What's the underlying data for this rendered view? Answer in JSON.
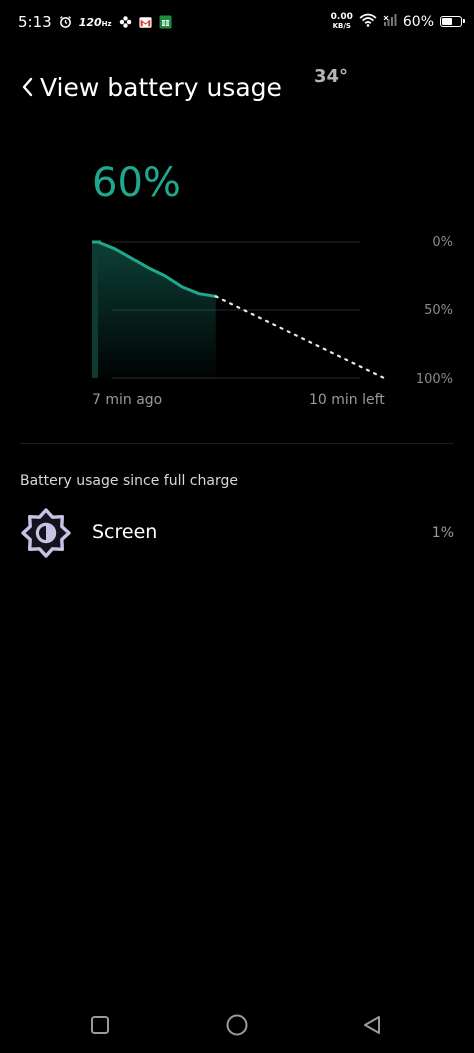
{
  "status_bar": {
    "time": "5:13",
    "refresh_rate": "120",
    "refresh_unit": "Hz",
    "net_speed_value": "0.00",
    "net_speed_unit": "KB/S",
    "battery_text": "60%",
    "battery_level": 0.6,
    "icons": [
      "alarm-icon",
      "pinwheel-icon",
      "gmail-icon",
      "sheets-icon",
      "wifi-icon",
      "signal-icon",
      "battery-icon"
    ]
  },
  "header": {
    "title": "View battery usage",
    "temperature": "34°"
  },
  "battery": {
    "percent": "60%",
    "accent_color": "#1fa88e"
  },
  "chart_data": {
    "type": "line",
    "y_axis_labels": [
      "0%",
      "50%",
      "100%"
    ],
    "x_labels": [
      "7 min ago",
      "10 min left"
    ],
    "ylim": [
      0,
      100
    ],
    "series": [
      {
        "style": "solid",
        "x_minutes": [
          -7.0,
          -6.0,
          -5.0,
          -4.0,
          -3.0,
          -2.0,
          -1.0,
          0.0
        ],
        "y_discharged": [
          0,
          5,
          12,
          19,
          25,
          33,
          38,
          40
        ]
      },
      {
        "style": "dotted",
        "x_minutes": [
          0.0,
          10.0
        ],
        "y_discharged": [
          40,
          100
        ]
      }
    ],
    "grid": true
  },
  "usage": {
    "section_title": "Battery usage since full charge",
    "items": [
      {
        "name": "Screen",
        "percent": "1%",
        "icon": "brightness-icon"
      }
    ]
  },
  "nav": {
    "buttons": [
      "recents-button",
      "home-button",
      "back-nav-button"
    ]
  }
}
